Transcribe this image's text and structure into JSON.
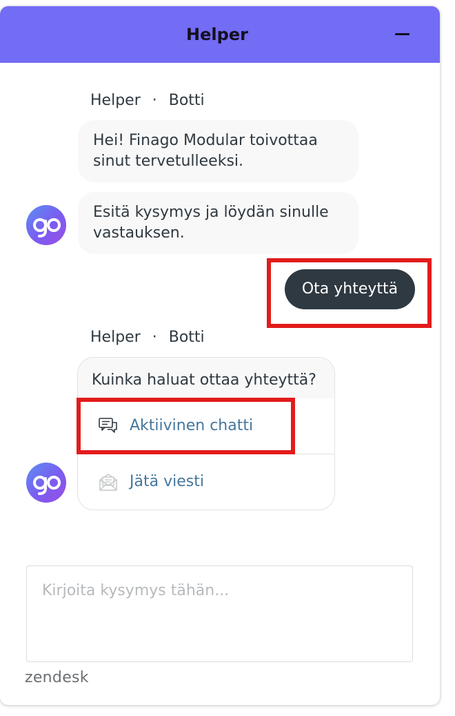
{
  "header": {
    "title": "Helper",
    "minimize_icon": "minimize-icon",
    "background_color": "#736cf5"
  },
  "messages": {
    "group1": {
      "sender_name": "Helper",
      "separator": "·",
      "sender_role": "Botti",
      "bubble1": "Hei! Finago Modular toivottaa sinut tervetulleeksi.",
      "bubble2": "Esitä kysymys ja löydän sinulle vastauksen.",
      "avatar_text": "go"
    },
    "user_reply": "Ota yhteyttä",
    "group2": {
      "sender_name": "Helper",
      "separator": "·",
      "sender_role": "Botti",
      "question": "Kuinka haluat ottaa yhteyttä?",
      "options": [
        {
          "label": "Aktiivinen chatti",
          "icon": "chat-icon"
        },
        {
          "label": "Jätä viesti",
          "icon": "envelope-icon"
        }
      ],
      "avatar_text": "go"
    }
  },
  "composer": {
    "placeholder": "Kirjoita kysymys tähän..."
  },
  "footer": {
    "brand": "zendesk"
  },
  "colors": {
    "accent": "#736cf5",
    "reply_button": "#2f3941",
    "link": "#45769b",
    "highlight": "#e21b1b"
  }
}
